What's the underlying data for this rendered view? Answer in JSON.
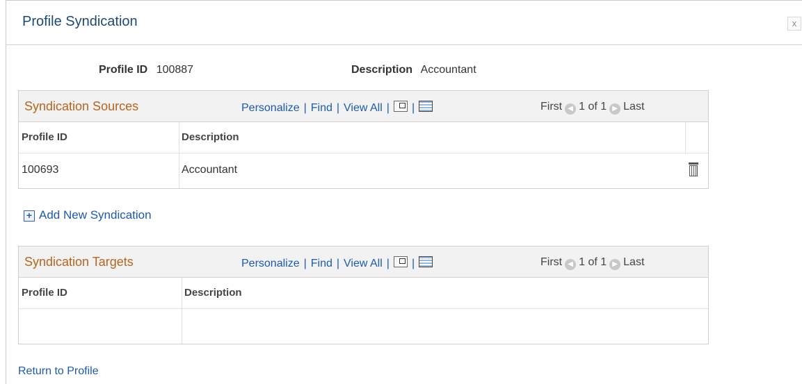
{
  "dialog": {
    "title": "Profile Syndication",
    "close_label": "x"
  },
  "summary": {
    "profile_id_label": "Profile ID",
    "profile_id_value": "100887",
    "description_label": "Description",
    "description_value": "Accountant"
  },
  "grid_nav": {
    "personalize": "Personalize",
    "find": "Find",
    "view_all": "View All",
    "separator": "|",
    "first": "First",
    "count": "1 of 1",
    "last": "Last"
  },
  "sources": {
    "title": "Syndication Sources",
    "columns": [
      "Profile ID",
      "Description"
    ],
    "rows": [
      {
        "profile_id": "100693",
        "description": "Accountant"
      }
    ]
  },
  "add_action": {
    "label": "Add New Syndication"
  },
  "targets": {
    "title": "Syndication Targets",
    "columns": [
      "Profile ID",
      "Description"
    ],
    "rows": []
  },
  "footer": {
    "return_link": "Return to Profile"
  },
  "colors": {
    "title": "#1f4a6e",
    "grid_title": "#b5651d",
    "link": "#1e5aa8"
  },
  "icons": [
    "close-icon",
    "zoom-icon",
    "spreadsheet-icon",
    "previous-arrow-icon",
    "next-arrow-icon",
    "trash-icon",
    "plus-icon"
  ]
}
